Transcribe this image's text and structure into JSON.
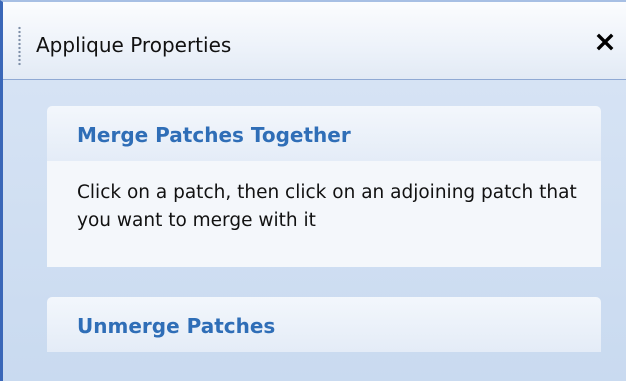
{
  "window": {
    "title": "Applique Properties",
    "close_icon": "close-icon"
  },
  "tasks": [
    {
      "title": "Merge Patches Together",
      "description": "Click on a patch, then click on an adjoining patch that you want to merge with it"
    },
    {
      "title": "Unmerge Patches"
    }
  ],
  "colors": {
    "frame_border": "#3a67b8",
    "panel_title": "#2f6eb7",
    "content_background": "#cfdff2"
  }
}
